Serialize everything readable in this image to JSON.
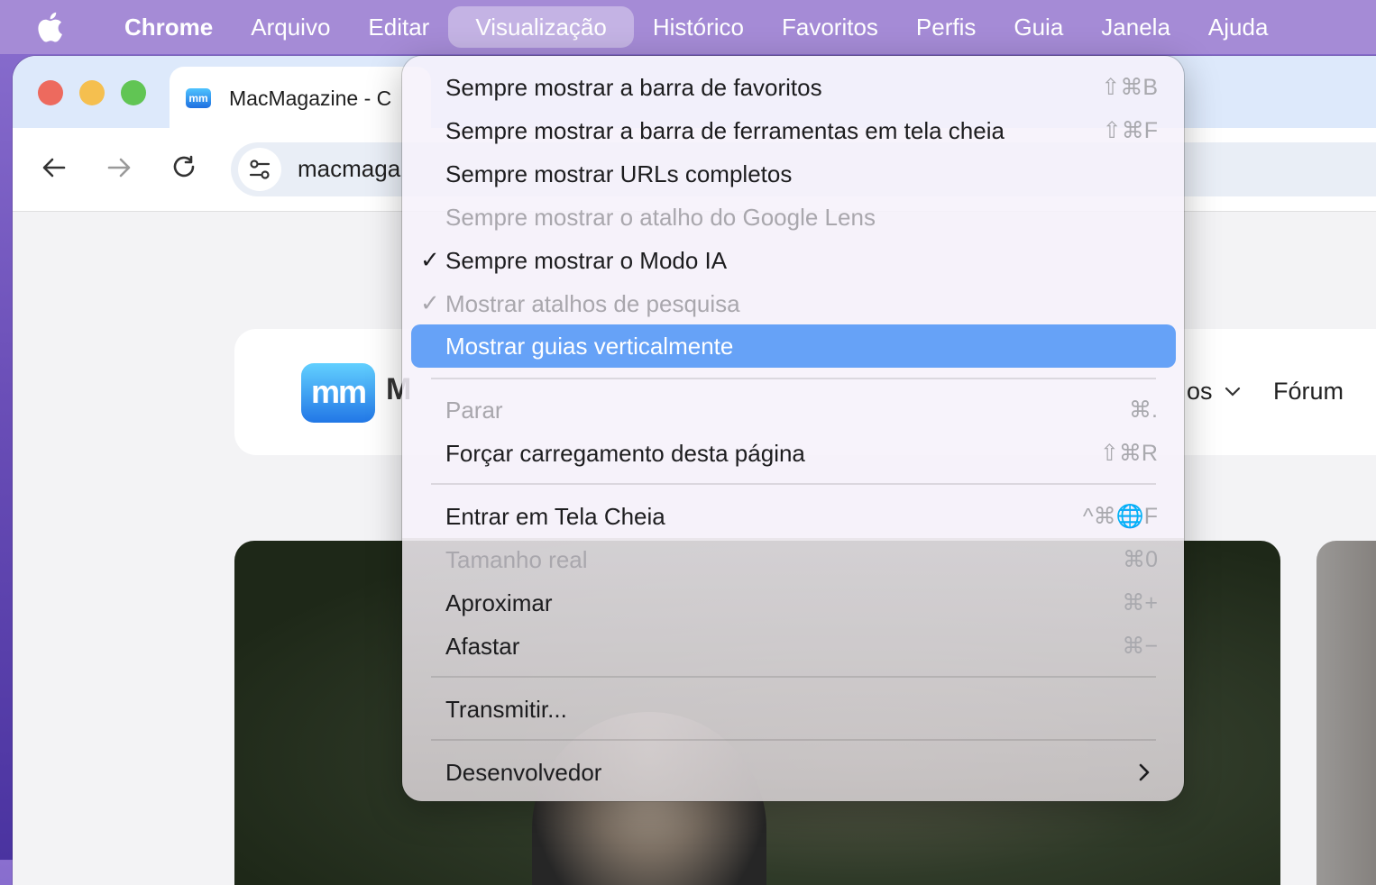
{
  "menubar": {
    "app": "Chrome",
    "items": [
      "Arquivo",
      "Editar",
      "Visualização",
      "Histórico",
      "Favoritos",
      "Perfis",
      "Guia",
      "Janela",
      "Ajuda"
    ],
    "active": "Visualização"
  },
  "browser": {
    "tab_title": "MacMagazine - C",
    "url": "macmaga",
    "favicon_text": "mm"
  },
  "site": {
    "logo_text": "mm",
    "name_fragment": "M",
    "nav_tail": "os",
    "nav_forum": "Fórum"
  },
  "menu": {
    "items": [
      {
        "label": "Sempre mostrar a barra de favoritos",
        "shortcut": "⇧⌘B",
        "state": "normal"
      },
      {
        "label": "Sempre mostrar a barra de ferramentas em tela cheia",
        "shortcut": "⇧⌘F",
        "state": "normal"
      },
      {
        "label": "Sempre mostrar URLs completos",
        "shortcut": "",
        "state": "normal"
      },
      {
        "label": "Sempre mostrar o atalho do Google Lens",
        "shortcut": "",
        "state": "disabled"
      },
      {
        "label": "Sempre mostrar o Modo IA",
        "shortcut": "",
        "state": "checked"
      },
      {
        "label": "Mostrar atalhos de pesquisa",
        "shortcut": "",
        "state": "checked-disabled"
      },
      {
        "label": "Mostrar guias verticalmente",
        "shortcut": "",
        "state": "highlighted"
      },
      {
        "label": "Parar",
        "shortcut": "⌘.",
        "state": "disabled"
      },
      {
        "label": "Forçar carregamento desta página",
        "shortcut": "⇧⌘R",
        "state": "normal"
      },
      {
        "label": "Entrar em Tela Cheia",
        "shortcut": "^⌘🌐F",
        "state": "normal"
      },
      {
        "label": "Tamanho real",
        "shortcut": "⌘0",
        "state": "disabled"
      },
      {
        "label": "Aproximar",
        "shortcut": "⌘+",
        "state": "normal"
      },
      {
        "label": "Afastar",
        "shortcut": "⌘−",
        "state": "normal"
      },
      {
        "label": "Transmitir...",
        "shortcut": "",
        "state": "normal"
      },
      {
        "label": "Desenvolvedor",
        "shortcut": "",
        "state": "submenu"
      }
    ],
    "checkmark": "✓"
  },
  "colors": {
    "menubar_bg": "#a58bd6",
    "highlight": "#66a2f7",
    "traffic_red": "#ed6a5e",
    "traffic_yellow": "#f5bf4f",
    "traffic_green": "#61c554"
  }
}
